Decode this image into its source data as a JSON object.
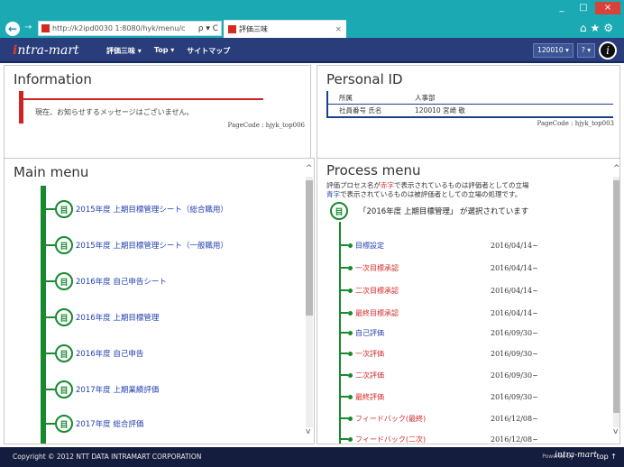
{
  "browser": {
    "url": "http://k2ipd0030 1:8080/hyk/menu/c",
    "addr_tools": "ρ ▾ C",
    "tab_title": "評価三味",
    "tab_close": "×",
    "nav_back": "←",
    "nav_forward": "→",
    "window_controls": [
      "_",
      "□",
      "×"
    ],
    "chrome_icons": "⌂★⚙"
  },
  "header": {
    "logo_i": "i",
    "logo_rest": "ntra-mart",
    "menu": [
      "評価三味 ▾",
      "Top ▾",
      "サイトマップ"
    ],
    "user_code": "120010 ▾",
    "help": "? ▾",
    "avatar_letter": "i"
  },
  "information": {
    "title": "Information",
    "message": "現在、お知らせするメッセージはございません。",
    "pagecode": "PageCode : hjyk_top006"
  },
  "personal_id": {
    "title": "Personal ID",
    "rows": [
      {
        "key": "所属",
        "value": "人事部"
      },
      {
        "key": "社員番号 氏名",
        "value": "120010 宮崎 敬"
      }
    ],
    "pagecode": "PageCode : hjyk_top003"
  },
  "main_menu": {
    "title": "Main menu",
    "collapse": "^",
    "items": [
      "2015年度 上期目標管理シート（総合職用）",
      "2015年度 上期目標管理シート（一般職用）",
      "2016年度 自己申告シート",
      "2016年度 上期目標管理",
      "2016年度 自己申告",
      "2017年度 上期業績評価",
      "2017年度 総合評価"
    ],
    "scroll_down": "v"
  },
  "process_menu": {
    "title": "Process menu",
    "desc1_pre": "評価プロセス名が",
    "desc1_mid": "赤字",
    "desc1_post": "で表示されているものは評価者としての立場",
    "desc2_mid": "青字",
    "desc2_post": "で表示されているものは被評価者としての立場の処理です。",
    "selected": "「2016年度 上期目標管理」 が選択されています",
    "collapse": "^",
    "scroll_down": "v",
    "items": [
      {
        "label": "目標設定",
        "date": "2016/04/14~",
        "color": "blue"
      },
      {
        "label": "一次目標承認",
        "date": "2016/04/14~",
        "color": "red"
      },
      {
        "label": "二次目標承認",
        "date": "2016/04/14~",
        "color": "red"
      },
      {
        "label": "最終目標承認",
        "date": "2016/04/14~",
        "color": "red"
      },
      {
        "label": "自己評価",
        "date": "2016/09/30~",
        "color": "blue"
      },
      {
        "label": "一次評価",
        "date": "2016/09/30~",
        "color": "red"
      },
      {
        "label": "二次評価",
        "date": "2016/09/30~",
        "color": "red"
      },
      {
        "label": "最終評価",
        "date": "2016/09/30~",
        "color": "red"
      },
      {
        "label": "フィードバック(最終)",
        "date": "2016/12/08~",
        "color": "red"
      },
      {
        "label": "フィードバック(二次)",
        "date": "2016/12/08~",
        "color": "red"
      }
    ]
  },
  "footer": {
    "copyright": "Copyright © 2012 NTT DATA INTRAMART CORPORATION",
    "powered": "Powered by",
    "logo": "intra-mart",
    "top": "top ↑"
  },
  "colors": {
    "chrome": "#1ba9b3",
    "header": "#283d7a",
    "menu_green": "#178a2f",
    "info_red": "#cf2323",
    "link_blue": "#2440b0",
    "footer": "#141d3d"
  }
}
